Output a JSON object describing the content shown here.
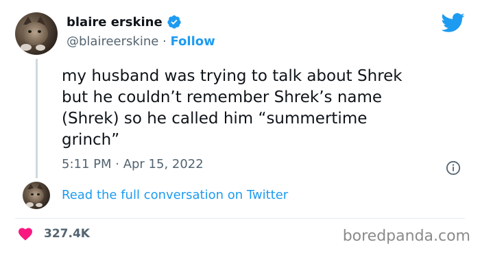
{
  "author": {
    "display_name": "blaire erskine",
    "handle": "@blaireerskine",
    "separator": " · ",
    "follow_label": "Follow",
    "verified_icon": "verified-badge-icon"
  },
  "tweet": {
    "lines": [
      "my husband was trying to talk about Shrek",
      "but he couldn’t remember Shrek’s name",
      "(Shrek) so he called him “summertime",
      "grinch”"
    ],
    "timestamp": "5:11 PM · Apr 15, 2022"
  },
  "conversation": {
    "link_label": "Read the full conversation on Twitter"
  },
  "engagement": {
    "like_count": "327.4K",
    "like_icon": "heart-icon"
  },
  "watermark": "boredpanda.com",
  "colors": {
    "twitter_blue": "#1d9bf0",
    "text_primary": "#0f1419",
    "text_secondary": "#536471",
    "heart": "#f91880",
    "watermark": "#8a8a8a"
  }
}
